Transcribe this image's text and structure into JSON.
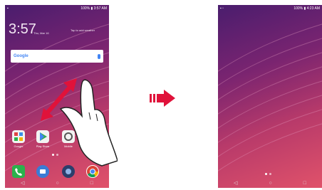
{
  "left": {
    "status_time": "3:57 AM",
    "status_battery": "100%",
    "clock": "3:57",
    "date": "Thu, Mar 16",
    "weather": "Tap to add weather",
    "search_logo": "Google",
    "apps": [
      {
        "label": "Google",
        "color": "#ffffff"
      },
      {
        "label": "Play Store",
        "color": "#ffffff"
      },
      {
        "label": "Mobile",
        "color": "#ffffff"
      }
    ]
  },
  "right": {
    "status_time": "4:23 AM",
    "status_battery": "100%"
  },
  "colors": {
    "arrow": "#e0123a",
    "phone_icon": "#2bb24c",
    "message_icon": "#3a7bd5"
  }
}
